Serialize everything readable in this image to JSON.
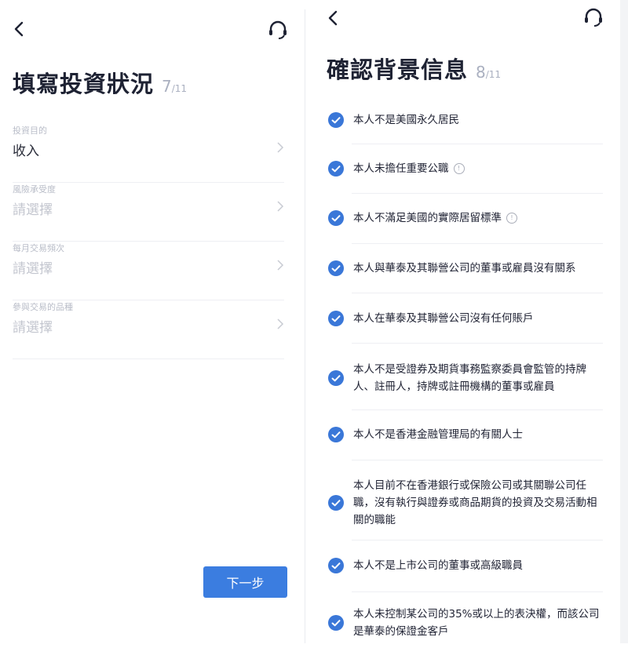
{
  "left": {
    "title": "填寫投資狀況",
    "step_current": "7",
    "step_total": "/11",
    "fields": [
      {
        "label": "投資目的",
        "value": "收入"
      },
      {
        "label": "風險承受度",
        "value": "請選擇"
      },
      {
        "label": "每月交易頻次",
        "value": "請選擇"
      },
      {
        "label": "參與交易的品種",
        "value": "請選擇"
      }
    ],
    "next_label": "下一步"
  },
  "right": {
    "title": "確認背景信息",
    "step_current": "8",
    "step_total": "/11",
    "items": [
      {
        "text": "本人不是美國永久居民"
      },
      {
        "text": "本人未擔任重要公職",
        "info_icon": "info-icon"
      },
      {
        "text": "本人不滿足美國的實際居留標準",
        "info_icon": "info-icon"
      },
      {
        "text": "本人與華泰及其聯營公司的董事或雇員沒有關系"
      },
      {
        "text": "本人在華泰及其聯營公司沒有任何賬戶"
      },
      {
        "text": "本人不是受證券及期貨事務監察委員會監管的持牌人、註冊人，持牌或註冊機構的董事或雇員"
      },
      {
        "text": "本人不是香港金融管理局的有關人士"
      },
      {
        "text": "本人目前不在香港銀行或保險公司或其關聯公司任職，沒有執行與證券或商品期貨的投資及交易活動相關的職能"
      },
      {
        "text": "本人不是上市公司的董事或高級職員"
      },
      {
        "text": "本人未控制某公司的35%或以上的表決權，而該公司是華泰的保證金客戶"
      }
    ]
  },
  "icons": {
    "back": "chevron-left-icon",
    "support": "headset-icon",
    "row_arrow": "chevron-right-icon",
    "check": "check-circle-icon"
  },
  "colors": {
    "accent": "#3b7de0",
    "check_fill": "#3a77d8",
    "title": "#1e2233",
    "muted": "#aab0c0"
  }
}
